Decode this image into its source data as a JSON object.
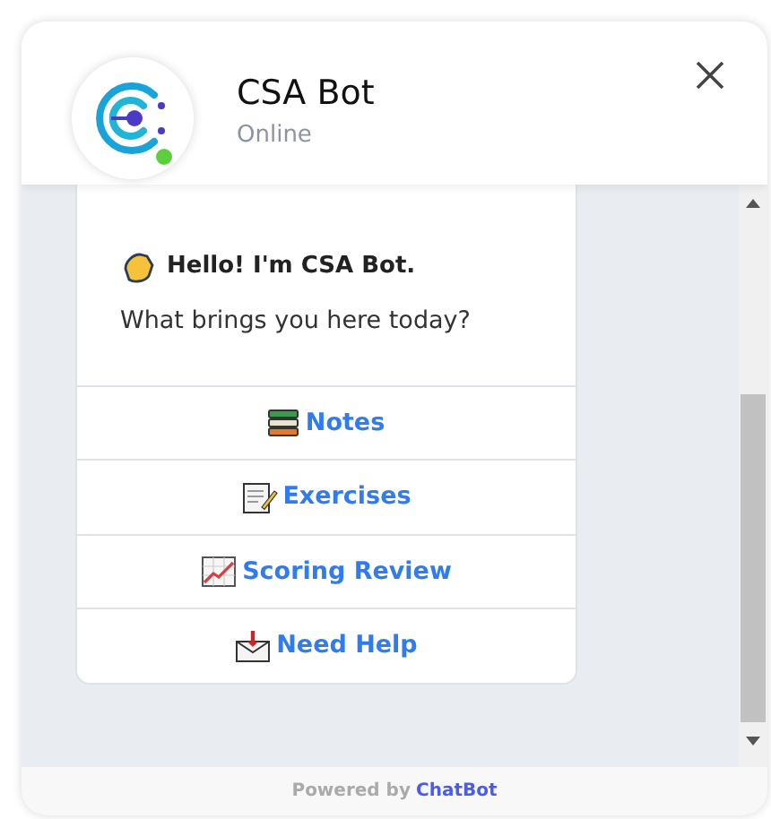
{
  "header": {
    "title": "CSA Bot",
    "status": "Online",
    "online": true
  },
  "message": {
    "greeting": "Hello! I'm CSA Bot.",
    "question": "What brings you here today?"
  },
  "buttons": [
    {
      "kind": "books",
      "label": "Notes"
    },
    {
      "kind": "memo",
      "label": "Exercises"
    },
    {
      "kind": "chart",
      "label": "Scoring Review"
    },
    {
      "kind": "inbox",
      "label": "Need Help"
    }
  ],
  "footer": {
    "text": "Powered by",
    "brand": "ChatBot"
  }
}
